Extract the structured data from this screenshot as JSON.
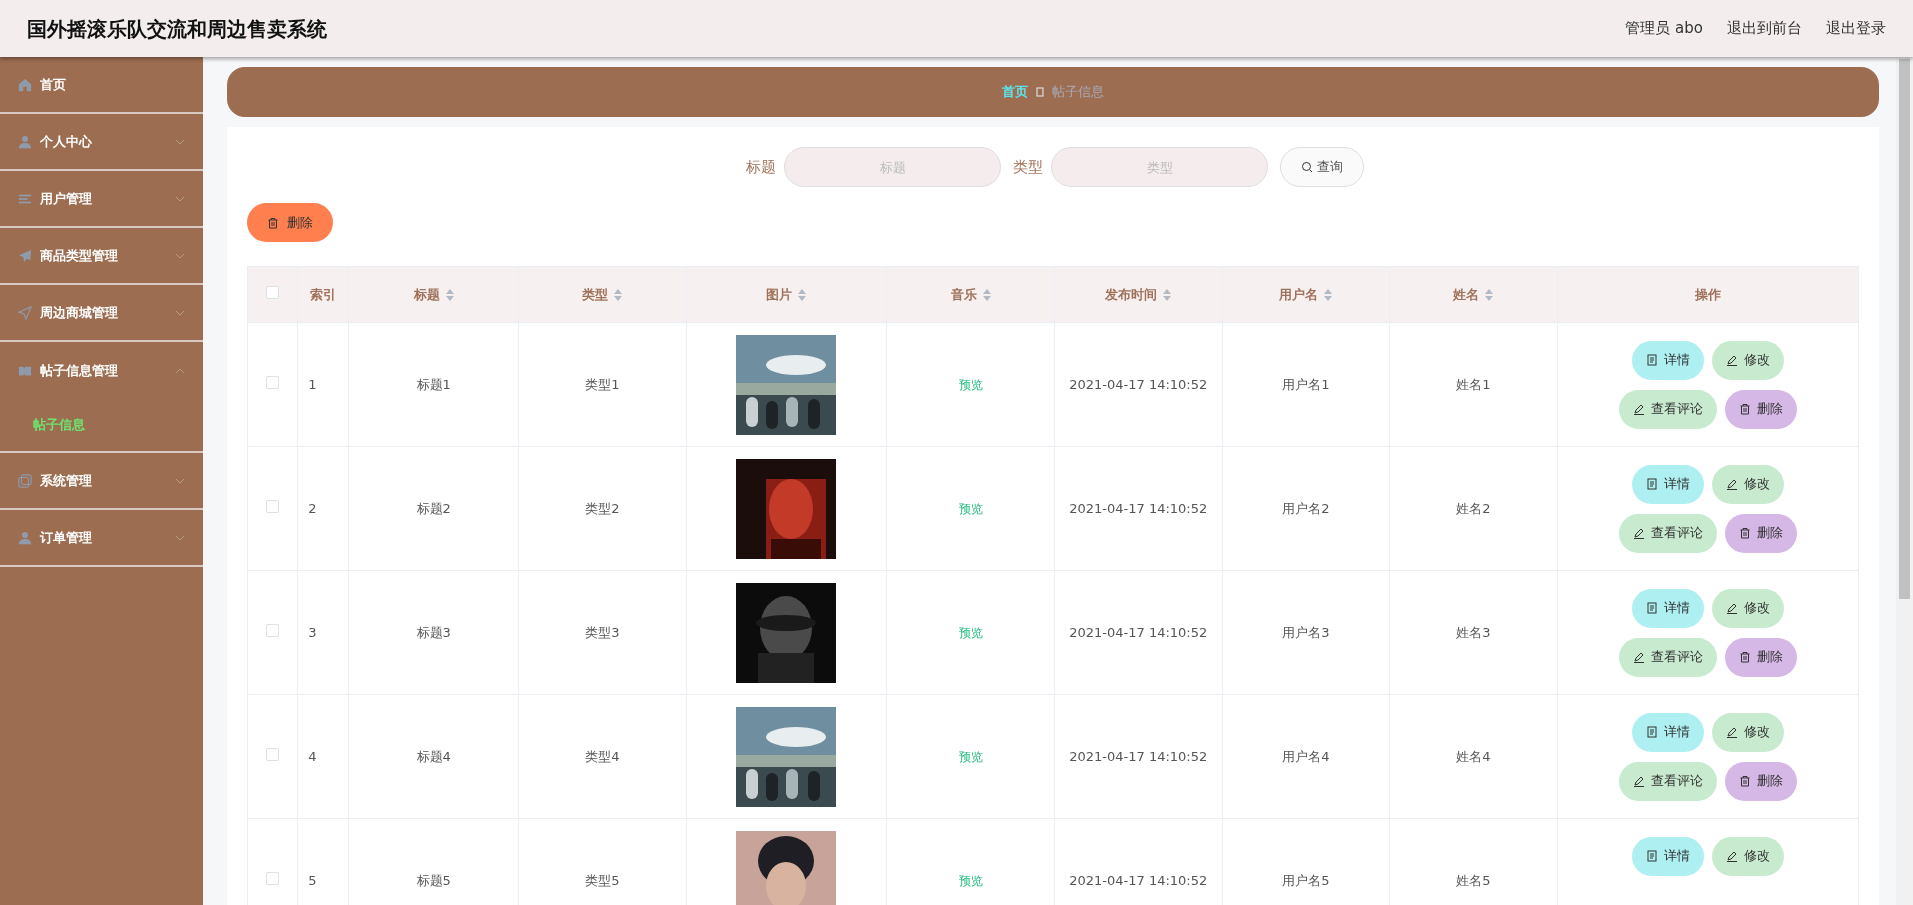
{
  "header": {
    "title": "国外摇滚乐队交流和周边售卖系统",
    "user": "管理员 abo",
    "links": [
      "退出到前台",
      "退出登录"
    ]
  },
  "sidebar": {
    "items": [
      {
        "label": "首页",
        "kind": "link"
      },
      {
        "label": "个人中心",
        "kind": "menu",
        "expanded": false
      },
      {
        "label": "用户管理",
        "kind": "menu",
        "expanded": false
      },
      {
        "label": "商品类型管理",
        "kind": "menu",
        "expanded": false
      },
      {
        "label": "周边商城管理",
        "kind": "menu",
        "expanded": false
      },
      {
        "label": "帖子信息管理",
        "kind": "menu",
        "expanded": true,
        "children": [
          {
            "label": "帖子信息",
            "selected": true
          }
        ]
      },
      {
        "label": "系统管理",
        "kind": "menu",
        "expanded": false
      },
      {
        "label": "订单管理",
        "kind": "menu",
        "expanded": false
      }
    ]
  },
  "breadcrumb": [
    {
      "label": "首页",
      "current": false
    },
    {
      "label": "帖子信息",
      "current": true
    }
  ],
  "search": {
    "fields": [
      {
        "label": "标题",
        "placeholder": "标题"
      },
      {
        "label": "类型",
        "placeholder": "类型"
      }
    ],
    "button": "查询"
  },
  "toolbar": {
    "delete_button": "删除"
  },
  "table": {
    "select_all_checked": false,
    "columns": [
      {
        "label": "索引",
        "sortable": false
      },
      {
        "label": "标题",
        "sortable": true
      },
      {
        "label": "类型",
        "sortable": true
      },
      {
        "label": "图片",
        "sortable": true
      },
      {
        "label": "音乐",
        "sortable": true
      },
      {
        "label": "发布时间",
        "sortable": true
      },
      {
        "label": "用户名",
        "sortable": true
      },
      {
        "label": "姓名",
        "sortable": true
      },
      {
        "label": "操作",
        "sortable": false
      }
    ],
    "rows": [
      {
        "checked": false,
        "index": "1",
        "title": "标题1",
        "type": "类型1",
        "music": "预览",
        "time": "2021-04-17 14:10:52",
        "username": "用户名1",
        "name": "姓名1",
        "actions": [
          {
            "label": "详情",
            "kind": "detail"
          },
          {
            "label": "修改",
            "kind": "edit"
          },
          {
            "label": "查看评论",
            "kind": "comments"
          },
          {
            "label": "删除",
            "kind": "delete"
          }
        ]
      },
      {
        "checked": false,
        "index": "2",
        "title": "标题2",
        "type": "类型2",
        "music": "预览",
        "time": "2021-04-17 14:10:52",
        "username": "用户名2",
        "name": "姓名2",
        "actions": [
          {
            "label": "详情",
            "kind": "detail"
          },
          {
            "label": "修改",
            "kind": "edit"
          },
          {
            "label": "查看评论",
            "kind": "comments"
          },
          {
            "label": "删除",
            "kind": "delete"
          }
        ]
      },
      {
        "checked": false,
        "index": "3",
        "title": "标题3",
        "type": "类型3",
        "music": "预览",
        "time": "2021-04-17 14:10:52",
        "username": "用户名3",
        "name": "姓名3",
        "actions": [
          {
            "label": "详情",
            "kind": "detail"
          },
          {
            "label": "修改",
            "kind": "edit"
          },
          {
            "label": "查看评论",
            "kind": "comments"
          },
          {
            "label": "删除",
            "kind": "delete"
          }
        ]
      },
      {
        "checked": false,
        "index": "4",
        "title": "标题4",
        "type": "类型4",
        "music": "预览",
        "time": "2021-04-17 14:10:52",
        "username": "用户名4",
        "name": "姓名4",
        "actions": [
          {
            "label": "详情",
            "kind": "detail"
          },
          {
            "label": "修改",
            "kind": "edit"
          },
          {
            "label": "查看评论",
            "kind": "comments"
          },
          {
            "label": "删除",
            "kind": "delete"
          }
        ]
      },
      {
        "checked": false,
        "index": "5",
        "title": "标题5",
        "type": "类型5",
        "music": "预览",
        "time": "2021-04-17 14:10:52",
        "username": "用户名5",
        "name": "姓名5",
        "actions": [
          {
            "label": "详情",
            "kind": "detail"
          },
          {
            "label": "修改",
            "kind": "edit"
          }
        ]
      }
    ]
  }
}
